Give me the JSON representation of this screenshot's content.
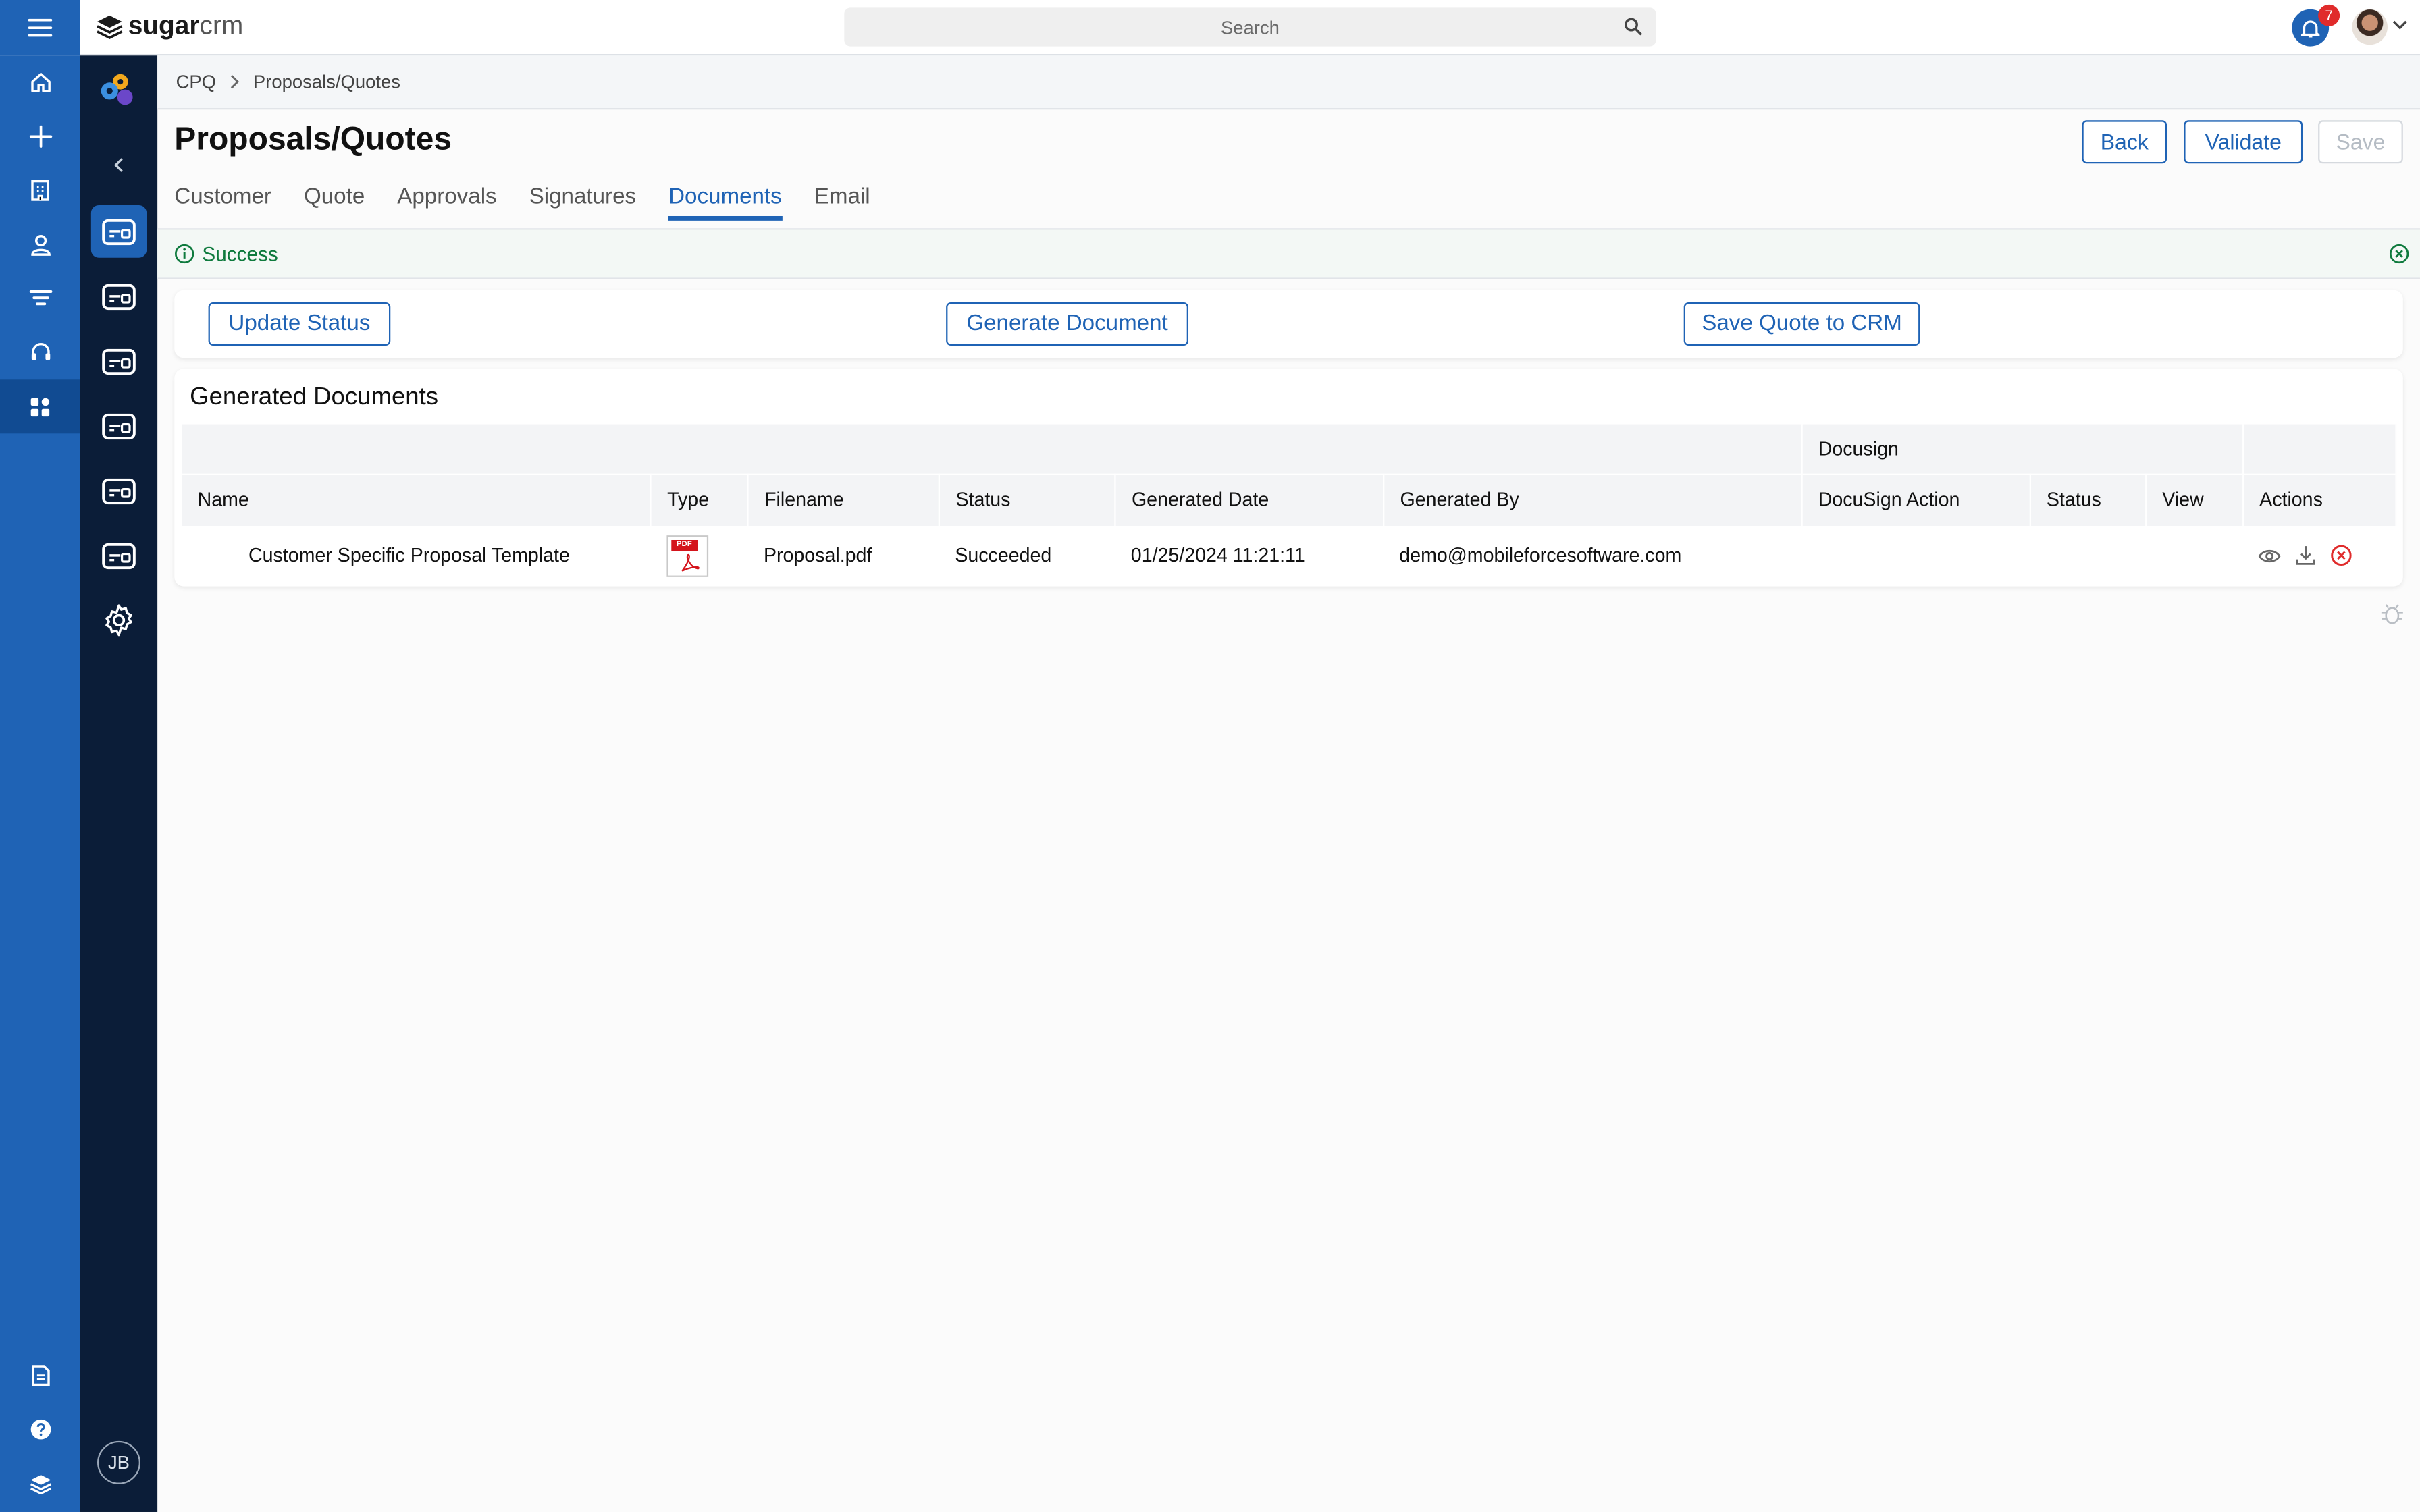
{
  "topbar": {
    "logo_bold": "sugar",
    "logo_light": "crm",
    "search_placeholder": "Search",
    "notification_count": "7"
  },
  "rail": {
    "initials": "JB"
  },
  "breadcrumb": [
    "CPQ",
    "Proposals/Quotes"
  ],
  "page": {
    "title": "Proposals/Quotes",
    "back_label": "Back",
    "validate_label": "Validate",
    "save_label": "Save"
  },
  "tabs": [
    "Customer",
    "Quote",
    "Approvals",
    "Signatures",
    "Documents",
    "Email"
  ],
  "active_tab": "Documents",
  "alert": {
    "text": "Success"
  },
  "actions": {
    "update_status": "Update Status",
    "generate_document": "Generate Document",
    "save_quote": "Save Quote to CRM"
  },
  "documents": {
    "title": "Generated Documents",
    "group_header": "Docusign",
    "columns": [
      "Name",
      "Type",
      "Filename",
      "Status",
      "Generated Date",
      "Generated By",
      "DocuSign Action",
      "Status",
      "View",
      "Actions"
    ],
    "rows": [
      {
        "name": "Customer Specific Proposal Template",
        "type": "PDF",
        "filename": "Proposal.pdf",
        "status": "Succeeded",
        "generated_date": "01/25/2024 11:21:11",
        "generated_by": "demo@mobileforcesoftware.com",
        "docusign_action": "",
        "docusign_status": "",
        "view": ""
      }
    ]
  },
  "colors": {
    "primary": "#1f63b5",
    "rail_dark": "#0b1d38",
    "success": "#0e7a3d",
    "danger": "#e02b2b"
  }
}
